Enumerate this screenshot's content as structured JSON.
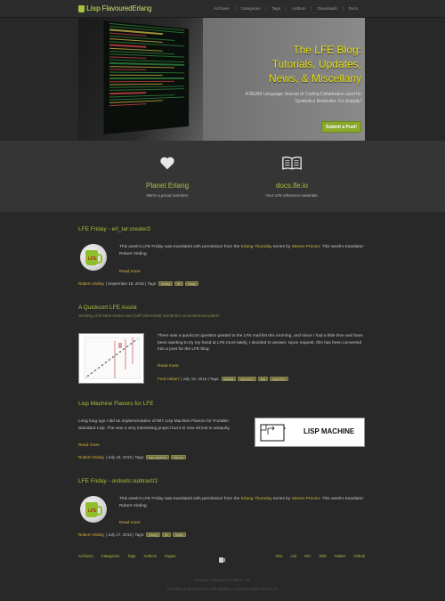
{
  "header": {
    "logo_lisp": "Lisp",
    "logo_rest": "FlavouredErlang",
    "nav": [
      "Archives",
      "Categories",
      "Tags",
      "Authors",
      "Downloads",
      "Docs"
    ]
  },
  "hero": {
    "title_line1": "The LFE Blog:",
    "title_line2": "Tutorials, Updates,",
    "title_line3": "News, & Miscellany",
    "subtitle": "A BEAM Language Journal of Coding Cellarbrains used for Symbolics Bestevike. It's sloppity!",
    "button": "Submit a Post!"
  },
  "features": [
    {
      "icon": "heart-icon",
      "title": "Planet Erlang",
      "sub": "We're a proud member!"
    },
    {
      "icon": "book-icon",
      "title": "docs.lfe.io",
      "sub": "Your LFE reference materials."
    }
  ],
  "posts": [
    {
      "title": "LFE Friday - erl_tar:create/2",
      "text_pre": "This week's LFE Friday was translated with permission from the ",
      "link1": "Erlang Thursday",
      "text_mid": " series by ",
      "link2": "Steven Proctor",
      "text_post": ". This week's translator: Robert Virding.",
      "readmore": "Read more",
      "author": "Robert Virding",
      "date": "| September 18, 2015 | Tags:",
      "tags": [
        "erlang",
        "lfe",
        "friday"
      ]
    },
    {
      "title": "A Quickcort LFE Assist",
      "subtitle": "Sending LFE Meta entries and (self-referential) Symbolics unconstrained plans!",
      "text": "There was a quickcort question posted to the LFE mail list this morning, and since I had a little time and have been wanting to try my hand at LFE more lately, I decided to answer. Upon request, this has been converted into a post for the LFE blog.",
      "readmore": "Read more",
      "author": "Fred Hebert",
      "date": "| July 18, 2015 | Tags:",
      "tags": [
        "tutorial",
        "quickcort",
        "lisp",
        "algorithm"
      ]
    },
    {
      "title": "Lisp Machine Flavors for LFE",
      "text": "Long long ago I did an implementation of MIT Lisp Machine Flavors for Portable Standard Lisp. The was a very interesting project but it is now all lost in antiquity.",
      "readmore": "Read more",
      "author": "Robert Virding",
      "date": "| July 16, 2015 | Tags:",
      "tags": [
        "lisp machine",
        "flavors"
      ],
      "image_label": "LISP MACHINE"
    },
    {
      "title": "LFE Friday - ordsets:subtract/2",
      "text_pre": "This week's LFE Friday was translated with permission from the ",
      "link1": "Erlang Thursday",
      "text_mid": " series by ",
      "link2": "Steven Proctor",
      "text_post": ". This week's translator: Robert Virding.",
      "readmore": "Read more",
      "author": "Robert Virding",
      "date": "| July 17, 2015 | Tags:",
      "tags": [
        "erlang",
        "lfe",
        "friday"
      ]
    }
  ],
  "footer": {
    "left": [
      "Archives",
      "Categories",
      "Tags",
      "Authors",
      "Pages"
    ],
    "right": [
      "Rss",
      "List",
      "IRC",
      "Wiki",
      "Twitter",
      "Github"
    ],
    "copy1": "Creative Commons © 2013 – 15",
    "copy2": "LFE Blog and Content © LFE Hackers. Licensed under CC-BY-SA"
  },
  "colors": {
    "accent": "#a5c33c",
    "gold": "#d6b63a",
    "bg": "#282828",
    "hero_title": "#e8e010"
  }
}
